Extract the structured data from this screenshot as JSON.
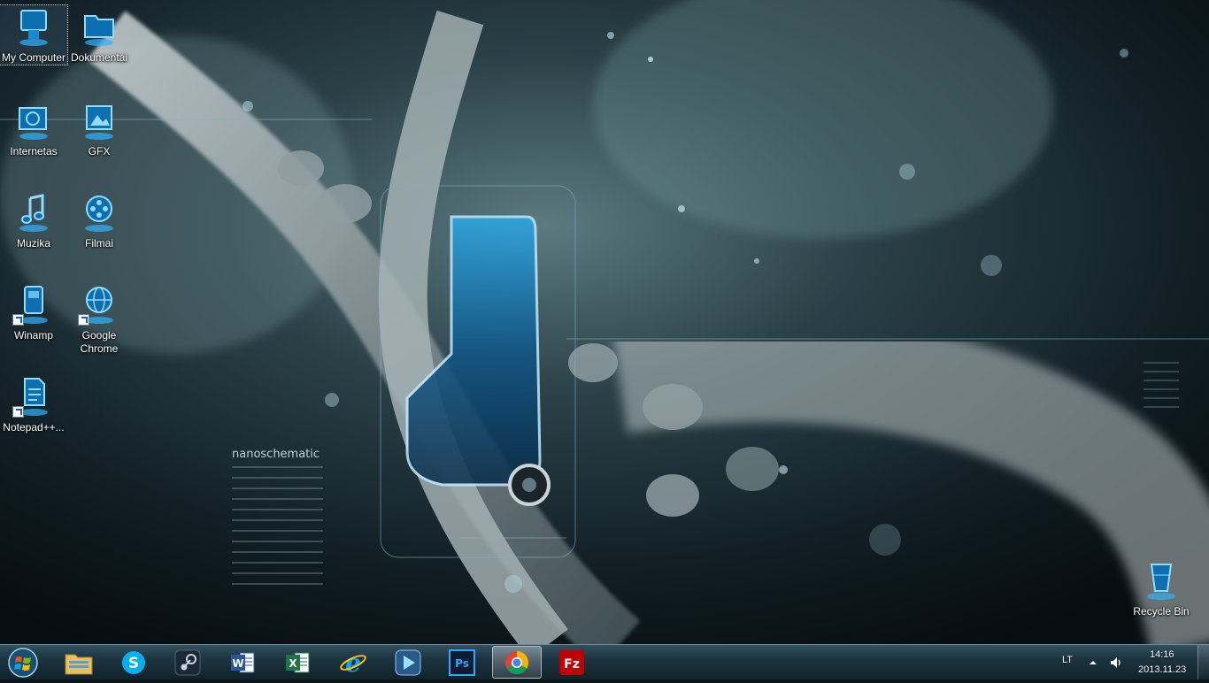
{
  "desktop": {
    "wallpaper_text": "nanoschematic",
    "icons": [
      {
        "label": "My Computer"
      },
      {
        "label": "Dokumentai"
      },
      {
        "label": "Internetas"
      },
      {
        "label": "GFX"
      },
      {
        "label": "Muzika"
      },
      {
        "label": "Filmai"
      },
      {
        "label": "Winamp"
      },
      {
        "label": "Google Chrome"
      },
      {
        "label": "Notepad++..."
      },
      {
        "label": "Recycle Bin"
      }
    ]
  },
  "taskbar": {
    "start_icon": "windows-orb-icon",
    "pinned": [
      {
        "name": "windows-explorer-icon",
        "active": false
      },
      {
        "name": "skype-icon",
        "active": false
      },
      {
        "name": "steam-icon",
        "active": false
      },
      {
        "name": "word-icon",
        "active": false,
        "glyph": "W"
      },
      {
        "name": "excel-icon",
        "active": false,
        "glyph": "X"
      },
      {
        "name": "internet-explorer-icon",
        "active": false,
        "glyph": "e"
      },
      {
        "name": "media-player-icon",
        "active": false
      },
      {
        "name": "photoshop-icon",
        "active": false,
        "glyph": "Ps"
      },
      {
        "name": "chrome-icon",
        "active": true
      },
      {
        "name": "filezilla-icon",
        "active": false,
        "glyph": "Fz"
      }
    ],
    "tray": {
      "language": "LT",
      "time": "14:16",
      "date": "2013.11.23"
    }
  },
  "colors": {
    "icon_glow": "#2fb4ff",
    "taskbar_top": "#34505e",
    "taskbar_bottom": "#10232d"
  }
}
